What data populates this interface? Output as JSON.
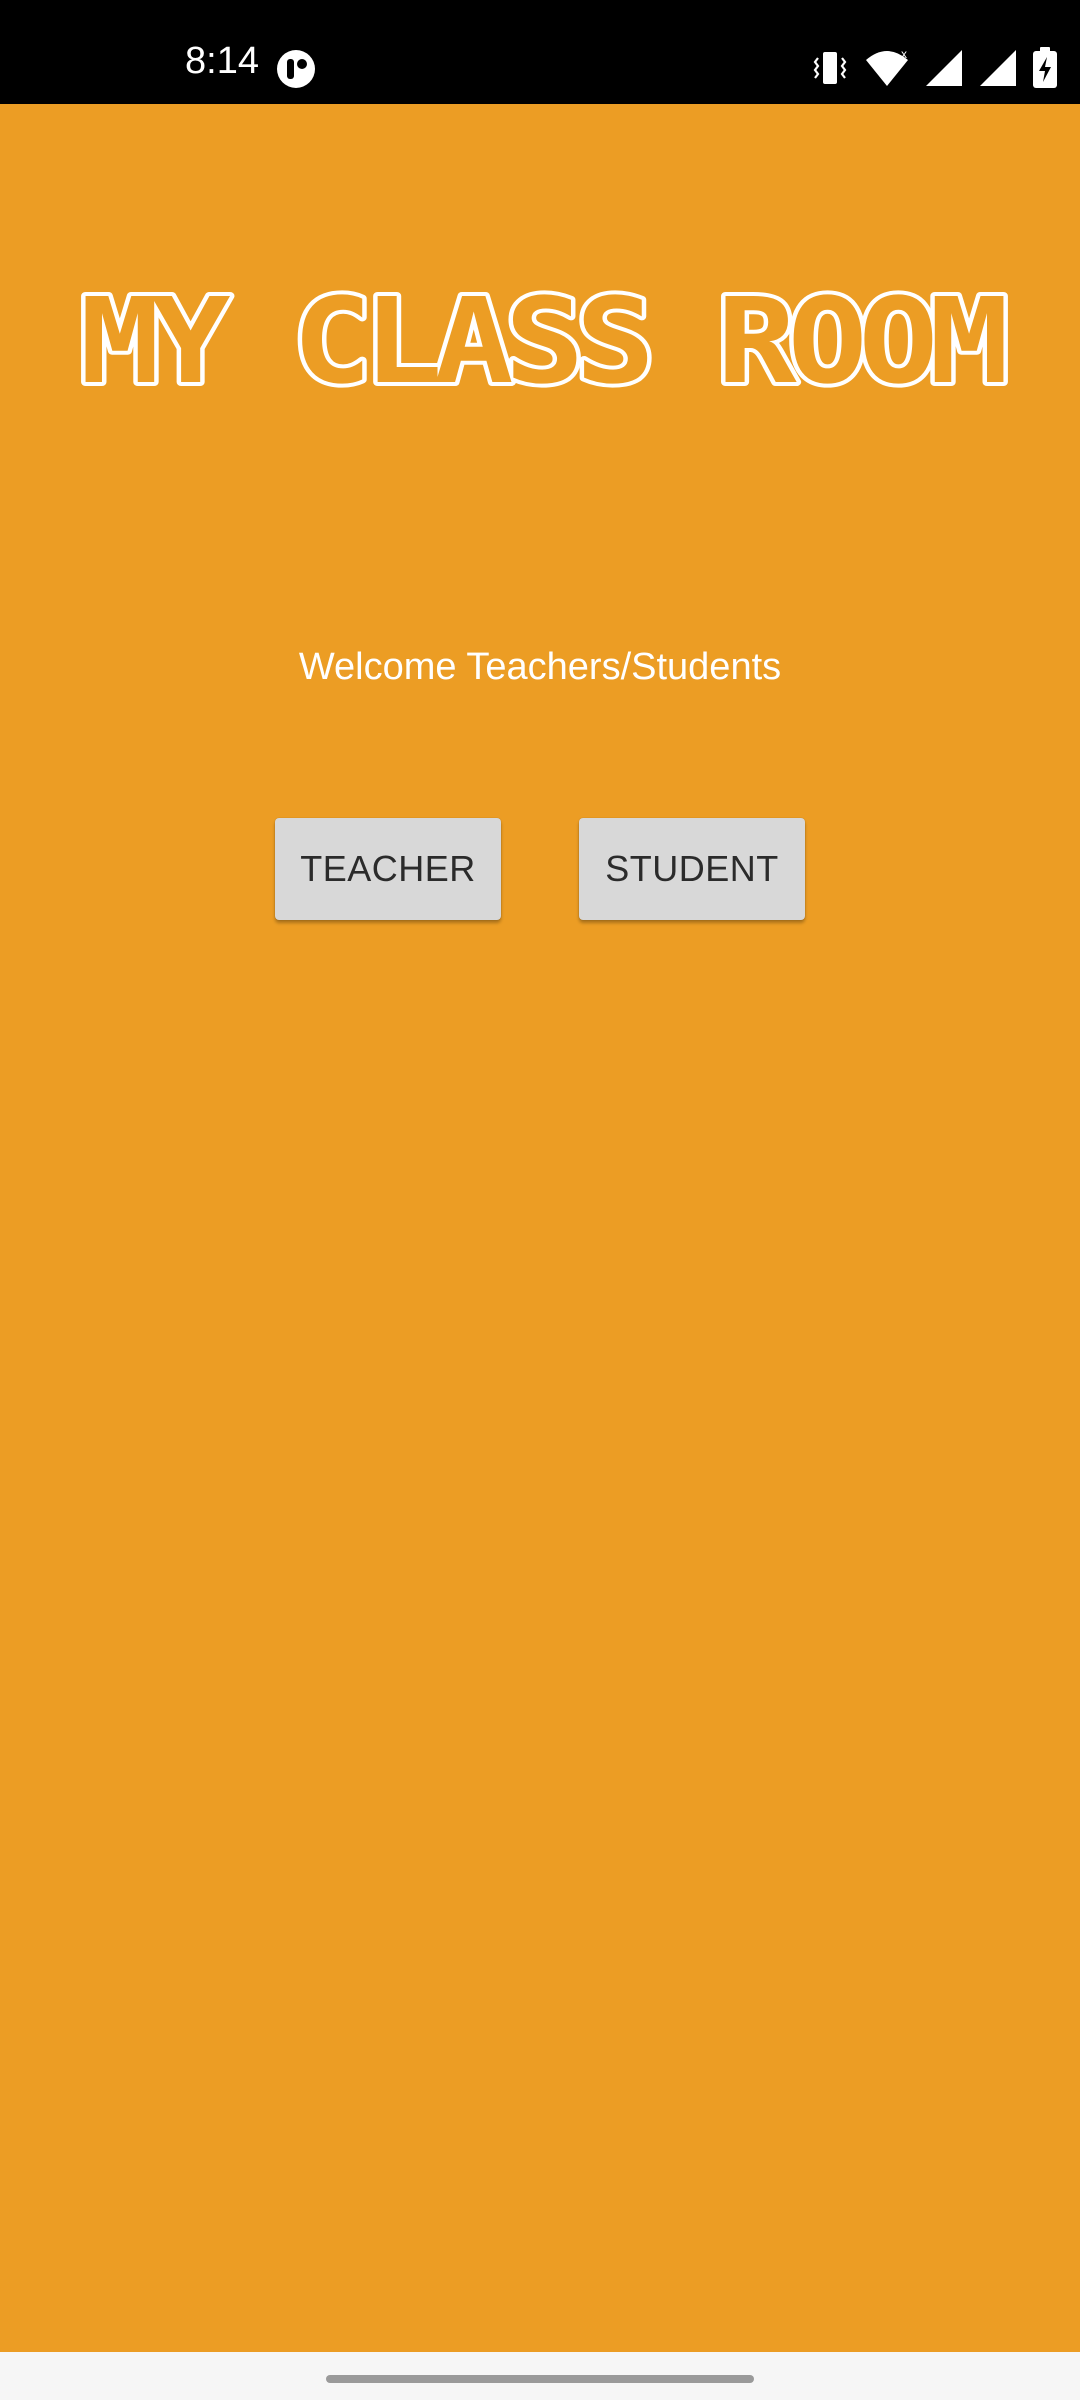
{
  "status_bar": {
    "time": "8:14",
    "icons": [
      "app-notification-icon",
      "vibrate-icon",
      "wifi-icon",
      "signal-icon",
      "signal-icon",
      "battery-charging-icon"
    ]
  },
  "app": {
    "title": "MY CLASS ROOM",
    "welcome_text": "Welcome Teachers/Students",
    "background_color": "#EC9D24",
    "buttons": {
      "teacher_label": "TEACHER",
      "student_label": "STUDENT"
    }
  }
}
